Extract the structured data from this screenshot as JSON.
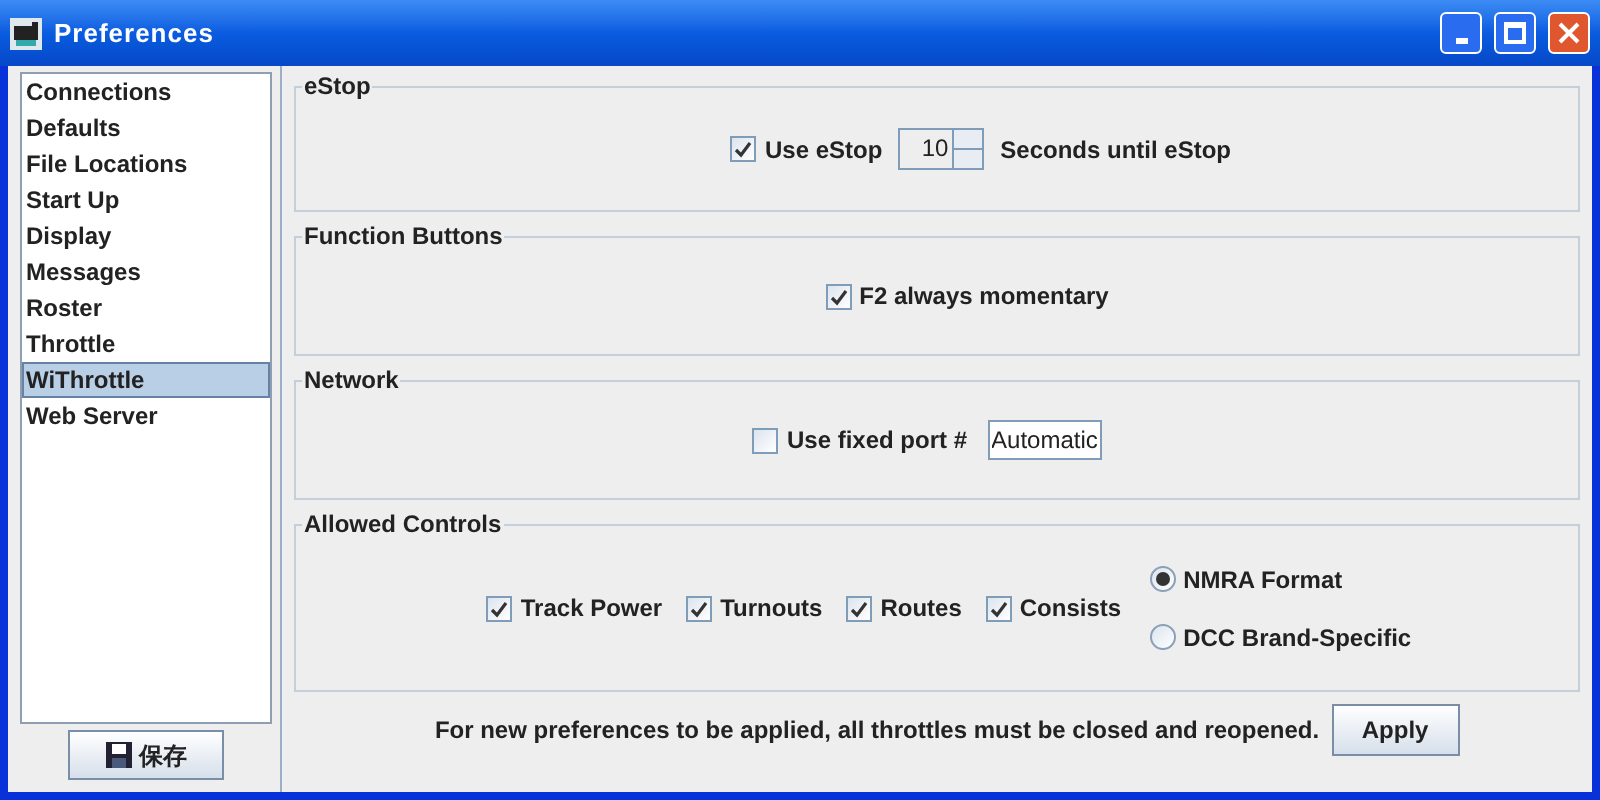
{
  "window": {
    "title": "Preferences"
  },
  "sidebar": {
    "items": [
      {
        "label": "Connections",
        "selected": false
      },
      {
        "label": "Defaults",
        "selected": false
      },
      {
        "label": "File Locations",
        "selected": false
      },
      {
        "label": "Start Up",
        "selected": false
      },
      {
        "label": "Display",
        "selected": false
      },
      {
        "label": "Messages",
        "selected": false
      },
      {
        "label": "Roster",
        "selected": false
      },
      {
        "label": "Throttle",
        "selected": false
      },
      {
        "label": "WiThrottle",
        "selected": true
      },
      {
        "label": "Web Server",
        "selected": false
      }
    ],
    "save_button": {
      "label": "保存"
    }
  },
  "estop": {
    "title": "eStop",
    "checkbox": {
      "label": "Use eStop",
      "checked": true
    },
    "spinner": {
      "value": "10"
    },
    "suffix": "Seconds until eStop"
  },
  "function_buttons": {
    "title": "Function Buttons",
    "checkbox": {
      "label": "F2 always momentary",
      "checked": true
    }
  },
  "network": {
    "title": "Network",
    "checkbox": {
      "label": "Use fixed port #",
      "checked": false
    },
    "port_field": {
      "value": "Automatic"
    }
  },
  "allowed_controls": {
    "title": "Allowed Controls",
    "checkboxes": [
      {
        "label": "Track Power",
        "checked": true
      },
      {
        "label": "Turnouts",
        "checked": true
      },
      {
        "label": "Routes",
        "checked": true
      },
      {
        "label": "Consists",
        "checked": true
      }
    ],
    "radios": [
      {
        "label": "NMRA Format",
        "selected": true
      },
      {
        "label": "DCC Brand-Specific",
        "selected": false
      }
    ]
  },
  "footer": {
    "message": "For new preferences to be applied, all throttles must be closed and reopened.",
    "apply_button": "Apply"
  }
}
